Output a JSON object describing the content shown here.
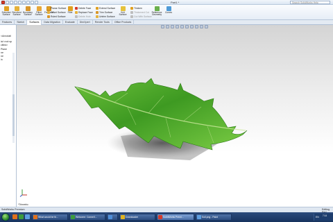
{
  "window": {
    "title": "Part1 *",
    "help_search_placeholder": "Search SolidWorks Help"
  },
  "ribbon": {
    "groups": [
      {
        "label": "Extruded Surface",
        "icon": "extruded-surface-icon"
      },
      {
        "label": "Revolved Surface",
        "icon": "revolved-surface-icon"
      },
      {
        "label": "Boundary Surface",
        "icon": "boundary-surface-icon"
      },
      {
        "label": "Filled Surface",
        "icon": "filled-surface-icon"
      },
      {
        "label": "Freeform",
        "icon": "freeform-icon"
      }
    ],
    "small_col_1": [
      "Planar Surface",
      "Offset Surface",
      "Ruled Surface"
    ],
    "fillet_label": "Fillet",
    "small_col_2": [
      "Delete Face",
      "Replace Face",
      "Delete Hole"
    ],
    "small_col_3": [
      "Extend Surface",
      "Trim Surface",
      "Untrim Surface"
    ],
    "knit_label": "Knit Surface",
    "small_col_4": [
      "Thicken",
      "Thickened Cut",
      "Cut With Surface"
    ],
    "ref_geometry_label": "Reference Geometry",
    "curves_label": "Curves"
  },
  "tabs": [
    "Features",
    "Sketch",
    "Surfaces",
    "Data Migration",
    "Evaluate",
    "DimXpert",
    "Render Tools",
    "Office Products"
  ],
  "active_tab": "Surfaces",
  "left_panel": {
    "lines": [
      "<Annotati",
      "ial <not sp",
      "cified>",
      "Plane",
      "ne",
      "ne",
      "in"
    ]
  },
  "viewport": {
    "model_status": "*Trimetric"
  },
  "status_bar": {
    "left": "SolidWorks Premium",
    "right": "Editing Part"
  },
  "taskbar": {
    "items": [
      {
        "label": "What would be th...",
        "icon": "firefox-icon",
        "color": "#e0701c"
      },
      {
        "label": "Welcome: ConneX...",
        "icon": "chrome-icon",
        "color": "#3c9b3c"
      },
      {
        "label": "",
        "icon": "network-icon",
        "color": "#4f8ed8"
      },
      {
        "label": "Downloader",
        "icon": "download-icon",
        "color": "#e0b320"
      },
      {
        "label": "SolidWorks Premi...",
        "icon": "solidworks-icon",
        "color": "#d43a2a"
      },
      {
        "label": "Soil.png - Paint",
        "icon": "paint-icon",
        "color": "#5d9de0"
      }
    ],
    "lang": "EN",
    "time": "7:14"
  },
  "colors": {
    "accent_red": "#d43a2a",
    "leaf_green": "#4ea52a",
    "ribbon_bg": "#e6edf6"
  }
}
